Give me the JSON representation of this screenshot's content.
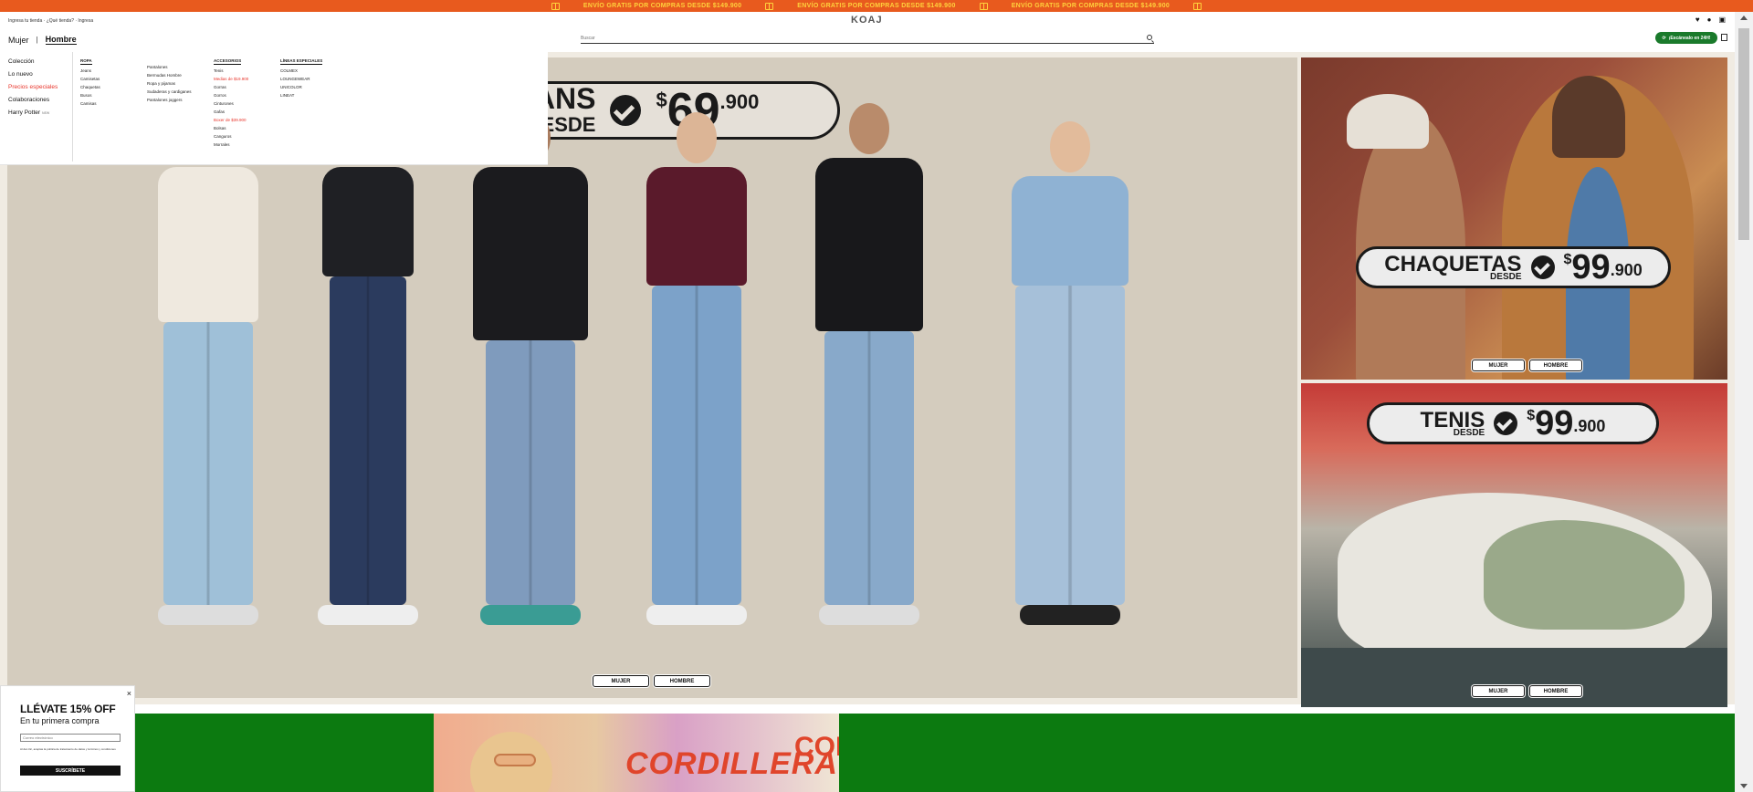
{
  "promo": {
    "items": [
      "ENVÍO GRATIS POR COMPRAS DESDE $149.900",
      "ENVÍO GRATIS POR COMPRAS DESDE $149.900",
      "ENVÍO GRATIS POR COMPRAS DESDE $149.900"
    ],
    "icon": "gift-icon"
  },
  "header": {
    "store_info": "Ingresa tu tienda · ¿Qué tienda? · Ingresa",
    "logo": "KOAJ",
    "gender_nav": [
      "Mujer",
      "|",
      "Hombre"
    ],
    "active_gender": "Hombre",
    "search_placeholder": "Buscar",
    "scan_button": "¡Escánealo en 24H!",
    "icons": [
      "heart-icon",
      "user-icon",
      "cart-icon",
      "calendar-icon"
    ]
  },
  "mega_menu": {
    "side_links": [
      "Colección",
      "Lo nuevo",
      "Precios especiales",
      "Colaboraciones",
      "Harry Potter"
    ],
    "side_highlight": "Precios especiales",
    "harry_potter_tag": "NEW",
    "columns": [
      {
        "head": "ROPA",
        "items": [
          "Jeans",
          "Camisetas",
          "Chaquetas",
          "Busos",
          "Camisas"
        ]
      },
      {
        "head": "",
        "items": [
          "Pantalones",
          "Bermudas Hombre",
          "Ropa y pijamas",
          "Sudaderas y cardiganes",
          "Pantalones joggers"
        ]
      },
      {
        "head": "ACCESORIOS",
        "items": [
          "Tenis",
          "Medias de $19.900",
          "Gorras",
          "Gorros",
          "Cinturones",
          "Gafas",
          "Boxer de $39.900",
          "Bolsas",
          "Canguros",
          "Morrales"
        ],
        "red_items": [
          "Medias de $19.900",
          "Boxer de $39.900"
        ]
      },
      {
        "head": "LÍNEAS ESPECIALES",
        "items": [
          "COLMEX",
          "LOUNGEWEAR",
          "UNICOLOR",
          "LINEAT"
        ]
      }
    ]
  },
  "hero": {
    "badge_prefix": "ANS",
    "badge_desde": "DESDE",
    "price_symbol": "$",
    "price": "69",
    "price_decimals": ".900",
    "buttons": [
      "MUJER",
      "HOMBRE"
    ]
  },
  "card_jackets": {
    "title": "CHAQUETAS",
    "desde": "DESDE",
    "price_symbol": "$",
    "price": "99",
    "price_decimals": ".900",
    "buttons": [
      "MUJER",
      "HOMBRE"
    ]
  },
  "card_sneakers": {
    "title": "TENIS",
    "desde": "DESDE",
    "price_symbol": "$",
    "price": "99",
    "price_decimals": ".900",
    "buttons": [
      "MUJER",
      "HOMBRE"
    ]
  },
  "festival": {
    "text": "CORDILLERA",
    "text2": "COR"
  },
  "popup": {
    "close": "×",
    "title": "LLÉVATE 15% OFF",
    "subtitle": "En tu primera compra",
    "email_placeholder": "Correo electrónico",
    "legal": "Al dar clic, aceptas la política de tratamiento de datos y términos y condiciones",
    "submit": "SUSCRÍBETE"
  },
  "colors": {
    "promo_bg": "#e85a1e",
    "promo_text": "#ffd23c",
    "scan_button_bg": "#1a7a2b",
    "highlight": "#e8352b",
    "band_green": "#0c7a10"
  }
}
